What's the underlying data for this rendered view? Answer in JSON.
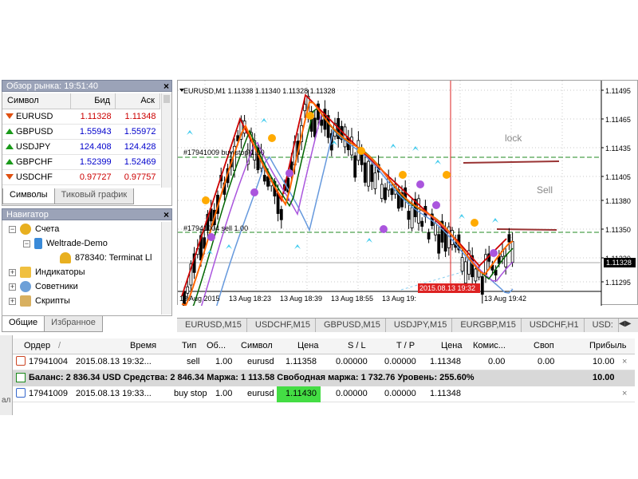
{
  "market_watch": {
    "title": "Обзор рынка: 19:51:40",
    "headers": {
      "symbol": "Символ",
      "bid": "Бид",
      "ask": "Аск"
    },
    "rows": [
      {
        "symbol": "EURUSD",
        "bid": "1.11328",
        "ask": "1.11348",
        "dir": "down",
        "color": "#cc0000"
      },
      {
        "symbol": "GBPUSD",
        "bid": "1.55943",
        "ask": "1.55972",
        "dir": "up",
        "color": "#0000cc"
      },
      {
        "symbol": "USDJPY",
        "bid": "124.408",
        "ask": "124.428",
        "dir": "up",
        "color": "#0000cc"
      },
      {
        "symbol": "GBPCHF",
        "bid": "1.52399",
        "ask": "1.52469",
        "dir": "up",
        "color": "#0000cc"
      },
      {
        "symbol": "USDCHF",
        "bid": "0.97727",
        "ask": "0.97757",
        "dir": "down",
        "color": "#cc0000"
      }
    ],
    "tabs": [
      "Символы",
      "Тиковый график"
    ]
  },
  "navigator": {
    "title": "Навигатор",
    "items": {
      "accounts": "Счета",
      "server": "Weltrade-Demo",
      "account": "878340: Terminat Ll",
      "indicators": "Индикаторы",
      "advisors": "Советники",
      "scripts": "Скрипты"
    },
    "tabs": [
      "Общие",
      "Избранное"
    ]
  },
  "chart": {
    "header": "EURUSD,M1  1.11338 1.11340 1.11328 1.11328",
    "order_label_buy": "#17941009 buy stop 1.00",
    "order_label_sell": "#17941004 sell 1.00",
    "lock_text": "lock",
    "sell_text": "Sell",
    "current_price_tag": "1.11328",
    "price_ticks": [
      "1.11495",
      "1.11465",
      "1.11435",
      "1.11405",
      "1.11380",
      "1.11350",
      "1.11320",
      "1.11295"
    ],
    "time_ticks": [
      "13 Aug 2015",
      "13 Aug 18:23",
      "13 Aug 18:39",
      "13 Aug 18:55",
      "13 Aug 19:"
    ],
    "time_ticks_after": "13 Aug 19:42",
    "cursor_time": "2015.08.13 19:32",
    "colors": {
      "candles": "#000000",
      "zigzag": "#cc0000",
      "ma_fast": "#ff6600",
      "ma_green": "#006600",
      "ma_purple": "#aa55dd",
      "ma_blue": "#6699dd",
      "levels": "#993333"
    },
    "tabs": [
      "EURUSD,M15",
      "USDCHF,M15",
      "GBPUSD,M15",
      "USDJPY,M15",
      "EURGBP,M15",
      "USDCHF,H1",
      "USD:"
    ]
  },
  "terminal": {
    "headers": {
      "order": "Ордер",
      "time": "Время",
      "type": "Тип",
      "volume": "Об...",
      "symbol": "Символ",
      "price": "Цена",
      "sl": "S / L",
      "tp": "T / P",
      "price2": "Цена",
      "commission": "Комис...",
      "swap": "Своп",
      "profit": "Прибыль"
    },
    "rows": [
      {
        "order": "17941004",
        "time": "2015.08.13 19:32...",
        "type": "sell",
        "volume": "1.00",
        "symbol": "eurusd",
        "price": "1.11358",
        "sl": "0.00000",
        "tp": "0.00000",
        "price2": "1.11348",
        "commission": "0.00",
        "swap": "0.00",
        "profit": "10.00"
      },
      {
        "order": "17941009",
        "time": "2015.08.13 19:33...",
        "type": "buy stop",
        "volume": "1.00",
        "symbol": "eurusd",
        "price": "1.11430",
        "sl": "0.00000",
        "tp": "0.00000",
        "price2": "1.11348",
        "commission": "",
        "swap": "",
        "profit": ""
      }
    ],
    "balance_line": "Баланс: 2 836.34 USD  Средства: 2 846.34  Маржа: 1 113.58  Свободная маржа: 1 732.76  Уровень: 255.60%",
    "balance_profit": "10.00",
    "side_label": "ал"
  }
}
